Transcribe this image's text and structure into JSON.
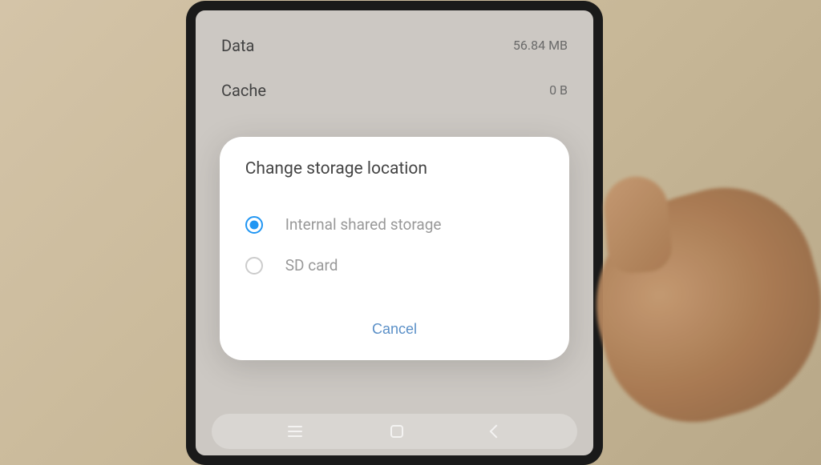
{
  "background": {
    "rows": [
      {
        "label": "Data",
        "value": "56.84 MB"
      },
      {
        "label": "Cache",
        "value": "0 B"
      }
    ]
  },
  "dialog": {
    "title": "Change storage location",
    "options": [
      {
        "label": "Internal shared storage",
        "selected": true
      },
      {
        "label": "SD card",
        "selected": false
      }
    ],
    "cancel": "Cancel"
  }
}
